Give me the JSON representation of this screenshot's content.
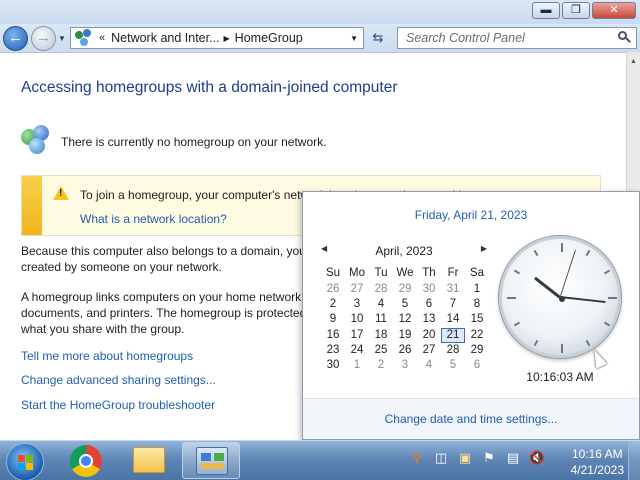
{
  "window": {
    "address_parts": [
      "Network and Inter...",
      "HomeGroup"
    ],
    "search_placeholder": "Search Control Panel"
  },
  "content": {
    "title": "Accessing homegroups with a domain-joined computer",
    "status": "There is currently no homegroup on your network.",
    "infobar": {
      "text": "To join a homegroup, your computer's network location must be set to Home.",
      "link": "What is a network location?"
    },
    "para1_lines": [
      "Because this computer also belongs to a domain, you",
      "created by someone on your network."
    ],
    "para2_lines": [
      "A homegroup links computers on your home network",
      "documents, and printers. The homegroup is protected",
      "what you share with the group."
    ],
    "links": [
      "Tell me more about homegroups",
      "Change advanced sharing settings...",
      "Start the HomeGroup troubleshooter"
    ]
  },
  "flyout": {
    "full_date": "Friday, April 21, 2023",
    "month_label": "April, 2023",
    "weekdays": [
      "Su",
      "Mo",
      "Tu",
      "We",
      "Th",
      "Fr",
      "Sa"
    ],
    "weeks": [
      [
        "26",
        "27",
        "28",
        "29",
        "30",
        "31",
        "1"
      ],
      [
        "2",
        "3",
        "4",
        "5",
        "6",
        "7",
        "8"
      ],
      [
        "9",
        "10",
        "11",
        "12",
        "13",
        "14",
        "15"
      ],
      [
        "16",
        "17",
        "18",
        "19",
        "20",
        "21",
        "22"
      ],
      [
        "23",
        "24",
        "25",
        "26",
        "27",
        "28",
        "29"
      ],
      [
        "30",
        "1",
        "2",
        "3",
        "4",
        "5",
        "6"
      ]
    ],
    "selected_day": "21",
    "clock_time": "10:16:03 AM",
    "analog": {
      "hour": 10,
      "minute": 16,
      "second": 3
    },
    "change_link": "Change date and time settings..."
  },
  "taskbar": {
    "time": "10:16 AM",
    "date": "4/21/2023",
    "items": [
      "start-button",
      "chrome",
      "windows-explorer",
      "control-panel"
    ]
  },
  "colors": {
    "link": "#1f5fae",
    "title": "#1e3d8c",
    "info_stripe": "#f0b51e"
  }
}
